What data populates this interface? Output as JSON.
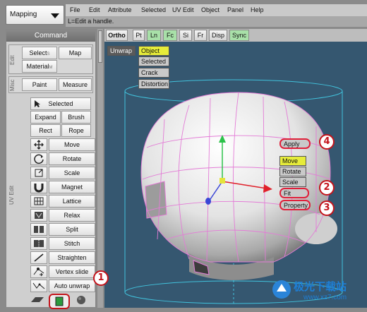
{
  "mode_select": {
    "label": "Mapping"
  },
  "menu": [
    "File",
    "Edit",
    "Attribute",
    "Selected",
    "UV Edit",
    "Object",
    "Panel",
    "Help"
  ],
  "status_hint": "L=Edit a handle.",
  "command_panel": {
    "title": "Command",
    "sections": {
      "edit": {
        "label": "Edit",
        "select": "Select",
        "select_shortcut": "S",
        "map": "Map",
        "material": "Material",
        "material_shortcut": "M"
      },
      "misc": {
        "label": "Misc",
        "paint": "Paint",
        "measure": "Measure"
      },
      "uv_edit": {
        "label": "UV Edit",
        "selected": "Selected",
        "expand": "Expand",
        "brush": "Brush",
        "rect": "Rect",
        "rope": "Rope",
        "tools": [
          {
            "icon": "move-icon",
            "label": "Move"
          },
          {
            "icon": "rotate-icon",
            "label": "Rotate"
          },
          {
            "icon": "scale-icon",
            "label": "Scale"
          },
          {
            "icon": "magnet-icon",
            "label": "Magnet"
          },
          {
            "icon": "lattice-icon",
            "label": "Lattice"
          },
          {
            "icon": "relax-icon",
            "label": "Relax"
          },
          {
            "icon": "split-icon",
            "label": "Split"
          },
          {
            "icon": "stitch-icon",
            "label": "Stitch"
          },
          {
            "icon": "straighten-icon",
            "label": "Straighten"
          },
          {
            "icon": "vertex-slide-icon",
            "label": "Vertex slide"
          },
          {
            "icon": "auto-unwrap-icon",
            "label": "Auto unwrap"
          }
        ]
      }
    }
  },
  "view_toolbar": {
    "buttons": [
      {
        "label": "Ortho",
        "state": "bold"
      },
      {
        "label": "Pt",
        "state": "normal"
      },
      {
        "label": "Ln",
        "state": "green"
      },
      {
        "label": "Fc",
        "state": "green"
      },
      {
        "label": "Si",
        "state": "normal"
      },
      {
        "label": "Fr",
        "state": "normal"
      },
      {
        "label": "Disp",
        "state": "normal"
      },
      {
        "label": "Sync",
        "state": "green"
      }
    ]
  },
  "viewport": {
    "unwrap": "Unwrap",
    "unwrap_menu": [
      "Object",
      "Selected",
      "Crack",
      "Distortion"
    ],
    "apply": "Apply",
    "transform_menu": [
      "Move",
      "Rotate",
      "Scale",
      "Fit",
      "Property"
    ]
  },
  "callouts": [
    "1",
    "2",
    "3",
    "4"
  ],
  "watermark": {
    "text": "极光下载站",
    "url": "www.xz7.com"
  },
  "colors": {
    "viewport_bg": "#355770",
    "accent_green": "#a8e0a8",
    "highlight_yellow": "#e6ec3a",
    "callout_red": "#c4141c"
  }
}
